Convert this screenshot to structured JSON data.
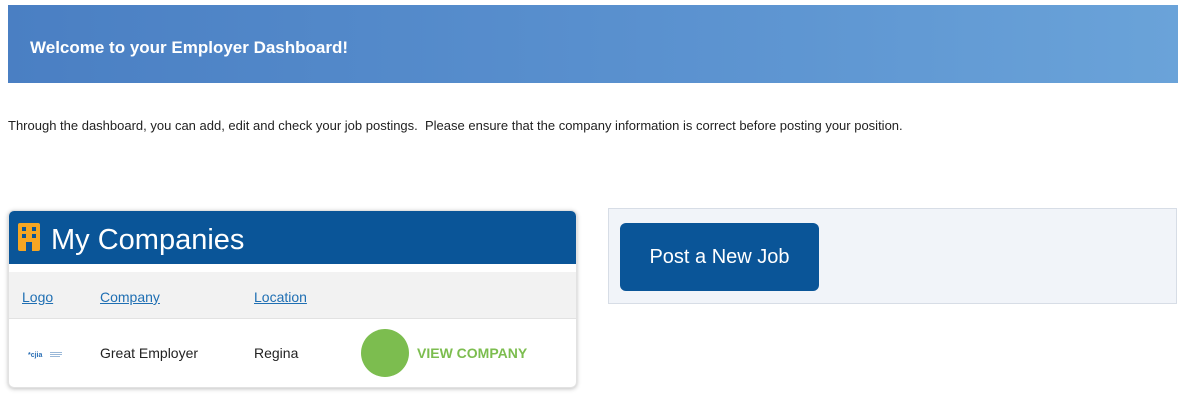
{
  "banner": {
    "title": "Welcome to your Employer Dashboard!"
  },
  "intro": {
    "text": "Through the dashboard, you can add, edit and check your job postings.  Please ensure that the company information is correct before posting your position."
  },
  "companies": {
    "title": "My Companies",
    "icon": "building-icon",
    "columns": {
      "logo": "Logo",
      "company": "Company",
      "location": "Location"
    },
    "rows": [
      {
        "logo_text": "*cjia",
        "company": "Great Employer",
        "location": "Regina",
        "action": "VIEW COMPANY"
      }
    ]
  },
  "post_job": {
    "label": "Post a New Job"
  },
  "colors": {
    "banner_start": "#4a7fc3",
    "banner_end": "#6aa3d9",
    "card_header": "#0a5598",
    "building_icon": "#f5a623",
    "link": "#1f6fb3",
    "view_action": "#7cbd4f",
    "post_button": "#0a5598"
  }
}
